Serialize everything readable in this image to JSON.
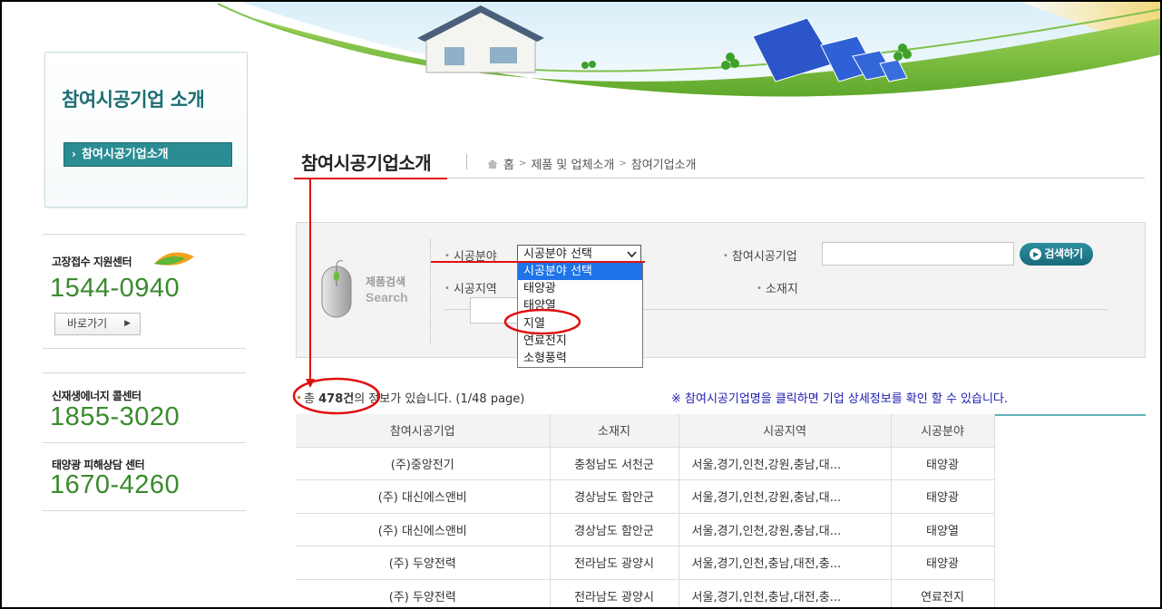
{
  "sidebar": {
    "title": "참여시공기업 소개",
    "menu_item": "참여시공기업소개",
    "contacts": [
      {
        "label": "고장접수 지원센터",
        "phone": "1544-0940"
      },
      {
        "label": "신재생에너지 콜센터",
        "phone": "1855-3020"
      },
      {
        "label": "태양광 피해상담 센터",
        "phone": "1670-4260"
      }
    ],
    "goto_label": "바로가기"
  },
  "header": {
    "title": "참여시공기업소개",
    "breadcrumb": [
      "홈",
      "제품 및 업체소개",
      "참여기업소개"
    ]
  },
  "search": {
    "caption_ko": "제품검색",
    "caption_en": "Search",
    "field_label": "시공분야",
    "field_value": "시공분야 선택",
    "company_label": "참여시공기업",
    "region_label": "시공지역",
    "location_label": "소재지",
    "button_label": "검색하기",
    "dropdown_options": [
      "시공분야 선택",
      "태양광",
      "태양열",
      "지열",
      "연료전지",
      "소형풍력"
    ]
  },
  "summary": {
    "prefix": "총",
    "count": "478건",
    "suffix": "의 정보가 있습니다. (1/48 page)",
    "notice": "※ 참여시공기업명을 클릭하면 기업 상세정보를 확인 할 수 있습니다."
  },
  "table": {
    "headers": [
      "참여시공기업",
      "소재지",
      "시공지역",
      "시공분야"
    ],
    "rows": [
      [
        "(주)중앙전기",
        "충청남도  서천군",
        "서울,경기,인천,강원,충남,대...",
        "태양광"
      ],
      [
        "(주) 대신에스앤비",
        "경상남도  함안군",
        "서울,경기,인천,강원,충남,대...",
        "태양광"
      ],
      [
        "(주) 대신에스앤비",
        "경상남도  함안군",
        "서울,경기,인천,강원,충남,대...",
        "태양열"
      ],
      [
        "(주) 두양전력",
        "전라남도  광양시",
        "서울,경기,인천,충남,대전,충...",
        "태양광"
      ],
      [
        "(주) 두양전력",
        "전라남도  광양시",
        "서울,경기,인천,충남,대전,충...",
        "연료전지"
      ]
    ]
  },
  "colors": {
    "accent": "#2a8d93",
    "phone_green": "#3a8a2d",
    "annotation_red": "#e01010",
    "dropdown_highlight": "#1e73e8"
  }
}
